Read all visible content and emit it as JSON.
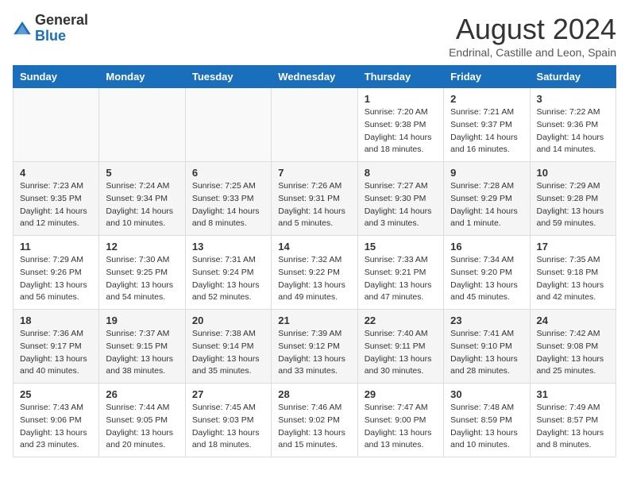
{
  "header": {
    "logo_general": "General",
    "logo_blue": "Blue",
    "title": "August 2024",
    "subtitle": "Endrinal, Castille and Leon, Spain"
  },
  "days_of_week": [
    "Sunday",
    "Monday",
    "Tuesday",
    "Wednesday",
    "Thursday",
    "Friday",
    "Saturday"
  ],
  "weeks": [
    [
      {
        "day": "",
        "info": ""
      },
      {
        "day": "",
        "info": ""
      },
      {
        "day": "",
        "info": ""
      },
      {
        "day": "",
        "info": ""
      },
      {
        "day": "1",
        "info": "Sunrise: 7:20 AM\nSunset: 9:38 PM\nDaylight: 14 hours\nand 18 minutes."
      },
      {
        "day": "2",
        "info": "Sunrise: 7:21 AM\nSunset: 9:37 PM\nDaylight: 14 hours\nand 16 minutes."
      },
      {
        "day": "3",
        "info": "Sunrise: 7:22 AM\nSunset: 9:36 PM\nDaylight: 14 hours\nand 14 minutes."
      }
    ],
    [
      {
        "day": "4",
        "info": "Sunrise: 7:23 AM\nSunset: 9:35 PM\nDaylight: 14 hours\nand 12 minutes."
      },
      {
        "day": "5",
        "info": "Sunrise: 7:24 AM\nSunset: 9:34 PM\nDaylight: 14 hours\nand 10 minutes."
      },
      {
        "day": "6",
        "info": "Sunrise: 7:25 AM\nSunset: 9:33 PM\nDaylight: 14 hours\nand 8 minutes."
      },
      {
        "day": "7",
        "info": "Sunrise: 7:26 AM\nSunset: 9:31 PM\nDaylight: 14 hours\nand 5 minutes."
      },
      {
        "day": "8",
        "info": "Sunrise: 7:27 AM\nSunset: 9:30 PM\nDaylight: 14 hours\nand 3 minutes."
      },
      {
        "day": "9",
        "info": "Sunrise: 7:28 AM\nSunset: 9:29 PM\nDaylight: 14 hours\nand 1 minute."
      },
      {
        "day": "10",
        "info": "Sunrise: 7:29 AM\nSunset: 9:28 PM\nDaylight: 13 hours\nand 59 minutes."
      }
    ],
    [
      {
        "day": "11",
        "info": "Sunrise: 7:29 AM\nSunset: 9:26 PM\nDaylight: 13 hours\nand 56 minutes."
      },
      {
        "day": "12",
        "info": "Sunrise: 7:30 AM\nSunset: 9:25 PM\nDaylight: 13 hours\nand 54 minutes."
      },
      {
        "day": "13",
        "info": "Sunrise: 7:31 AM\nSunset: 9:24 PM\nDaylight: 13 hours\nand 52 minutes."
      },
      {
        "day": "14",
        "info": "Sunrise: 7:32 AM\nSunset: 9:22 PM\nDaylight: 13 hours\nand 49 minutes."
      },
      {
        "day": "15",
        "info": "Sunrise: 7:33 AM\nSunset: 9:21 PM\nDaylight: 13 hours\nand 47 minutes."
      },
      {
        "day": "16",
        "info": "Sunrise: 7:34 AM\nSunset: 9:20 PM\nDaylight: 13 hours\nand 45 minutes."
      },
      {
        "day": "17",
        "info": "Sunrise: 7:35 AM\nSunset: 9:18 PM\nDaylight: 13 hours\nand 42 minutes."
      }
    ],
    [
      {
        "day": "18",
        "info": "Sunrise: 7:36 AM\nSunset: 9:17 PM\nDaylight: 13 hours\nand 40 minutes."
      },
      {
        "day": "19",
        "info": "Sunrise: 7:37 AM\nSunset: 9:15 PM\nDaylight: 13 hours\nand 38 minutes."
      },
      {
        "day": "20",
        "info": "Sunrise: 7:38 AM\nSunset: 9:14 PM\nDaylight: 13 hours\nand 35 minutes."
      },
      {
        "day": "21",
        "info": "Sunrise: 7:39 AM\nSunset: 9:12 PM\nDaylight: 13 hours\nand 33 minutes."
      },
      {
        "day": "22",
        "info": "Sunrise: 7:40 AM\nSunset: 9:11 PM\nDaylight: 13 hours\nand 30 minutes."
      },
      {
        "day": "23",
        "info": "Sunrise: 7:41 AM\nSunset: 9:10 PM\nDaylight: 13 hours\nand 28 minutes."
      },
      {
        "day": "24",
        "info": "Sunrise: 7:42 AM\nSunset: 9:08 PM\nDaylight: 13 hours\nand 25 minutes."
      }
    ],
    [
      {
        "day": "25",
        "info": "Sunrise: 7:43 AM\nSunset: 9:06 PM\nDaylight: 13 hours\nand 23 minutes."
      },
      {
        "day": "26",
        "info": "Sunrise: 7:44 AM\nSunset: 9:05 PM\nDaylight: 13 hours\nand 20 minutes."
      },
      {
        "day": "27",
        "info": "Sunrise: 7:45 AM\nSunset: 9:03 PM\nDaylight: 13 hours\nand 18 minutes."
      },
      {
        "day": "28",
        "info": "Sunrise: 7:46 AM\nSunset: 9:02 PM\nDaylight: 13 hours\nand 15 minutes."
      },
      {
        "day": "29",
        "info": "Sunrise: 7:47 AM\nSunset: 9:00 PM\nDaylight: 13 hours\nand 13 minutes."
      },
      {
        "day": "30",
        "info": "Sunrise: 7:48 AM\nSunset: 8:59 PM\nDaylight: 13 hours\nand 10 minutes."
      },
      {
        "day": "31",
        "info": "Sunrise: 7:49 AM\nSunset: 8:57 PM\nDaylight: 13 hours\nand 8 minutes."
      }
    ]
  ]
}
